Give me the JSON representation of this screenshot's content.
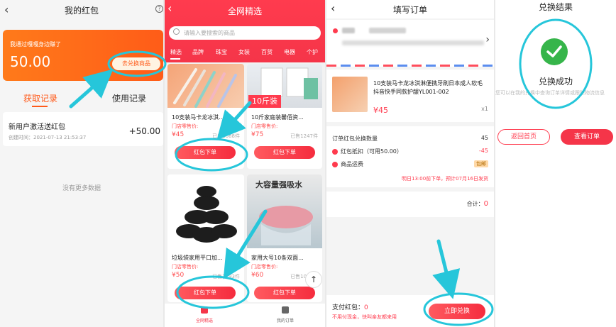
{
  "panel1": {
    "title": "我的红包",
    "help_icon": "question-circle-icon",
    "card_subtitle": "我通过嘎嘎身边赚了",
    "card_amount": "50.00",
    "redeem_label": "去兑换商品",
    "tab_records": "获取记录",
    "tab_usage": "使用记录",
    "record": {
      "title": "新用户激活送红包",
      "date": "创建时间：2021-07-13 21:53:37",
      "value": "+50.00"
    },
    "no_more": "没有更多数据"
  },
  "panel2": {
    "title": "全网精选",
    "search_placeholder": "请输入要搜索的商品",
    "categories": [
      "精选",
      "品牌",
      "珠宝",
      "女装",
      "百货",
      "电器",
      "个护"
    ],
    "products": [
      {
        "name": "10支装马卡龙冰淇...",
        "label": "门店零售价:",
        "price": "¥45",
        "sold": "已售1088件",
        "buy": "红包下单"
      },
      {
        "name": "10斤家庭装馨佰资...",
        "label": "门店零售价:",
        "price": "¥75",
        "sold": "已售1247件",
        "buy": "红包下单",
        "badge": "10斤装"
      },
      {
        "name": "垃圾袋家用平口加...",
        "label": "门店零售价:",
        "price": "¥50",
        "sold": "已售1293件",
        "buy": "红包下单"
      },
      {
        "name": "家用大号10条双面...",
        "label": "门店零售价:",
        "price": "¥60",
        "sold": "已售1088件",
        "buy": "红包下单",
        "banner": "大容量强吸水"
      }
    ],
    "bottom_nav": [
      {
        "label": "全网精选"
      },
      {
        "label": "我的订单"
      }
    ],
    "to_top": "↑"
  },
  "panel3": {
    "title": "填写订单",
    "product_name": "10支装马卡龙冰淇淋便携牙刷日本成人软毛抖音快手同款护龈YL001-002",
    "product_price": "¥45",
    "product_qty": "x1",
    "summary": [
      {
        "label": "订单红包兑换数量",
        "value": "45"
      },
      {
        "label": "红包抵扣（可用50.00）",
        "value": "-45"
      },
      {
        "label": "商品运费",
        "value": "包邮"
      }
    ],
    "shipping_note": "明日13:00前下单，预计07月16日发货",
    "total_label": "合计：",
    "total_value": "0",
    "pay_label": "支付红包：",
    "pay_value": "0",
    "pay_note": "不用付现金，快叫亲友都来用",
    "submit_label": "立即兑换"
  },
  "panel4": {
    "title": "兑换结果",
    "success": "兑换成功",
    "hint": "您可以在我的兑换中查询订单详情或跟踪物流信息",
    "btn_home": "返回首页",
    "btn_order": "查看订单"
  },
  "colors": {
    "brand_red": "#f53549",
    "orange": "#ff6a1a",
    "annotation_cyan": "#26c6da",
    "success_green": "#36b54a"
  }
}
